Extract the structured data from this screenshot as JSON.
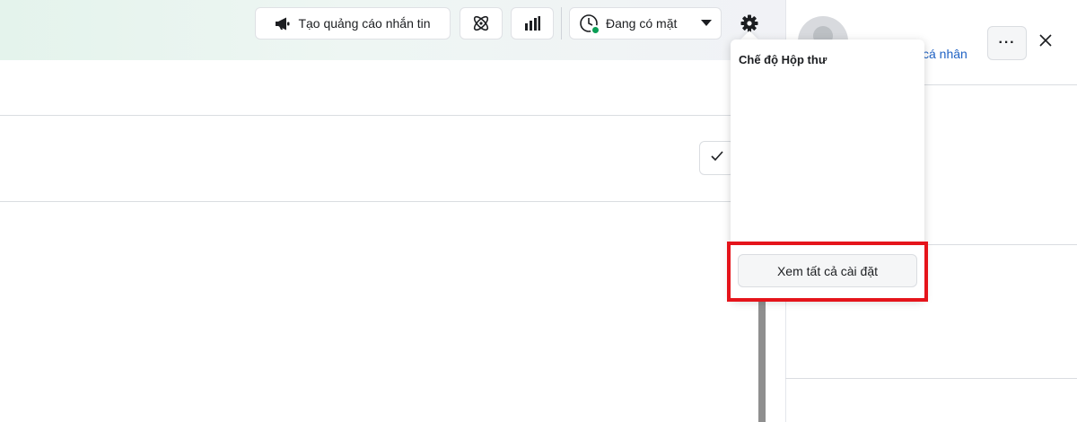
{
  "toolbar": {
    "create_ad_label": "Tạo quảng cáo nhắn tin",
    "presence_label": "Đang có mặt",
    "presence_color": "#0a9e55"
  },
  "settings_menu": {
    "title": "Chế độ Hộp thư",
    "view_all_label": "Xem tất cả cài đặt"
  },
  "right_panel": {
    "link_label": "cá nhân",
    "more_label": "···"
  },
  "colors": {
    "highlight": "#e5141b",
    "link": "#1f62c4"
  },
  "icons": [
    "megaphone-icon",
    "atom-icon",
    "bar-chart-icon",
    "presence-icon",
    "caret-down-icon",
    "gear-icon",
    "check-icon",
    "close-icon"
  ]
}
